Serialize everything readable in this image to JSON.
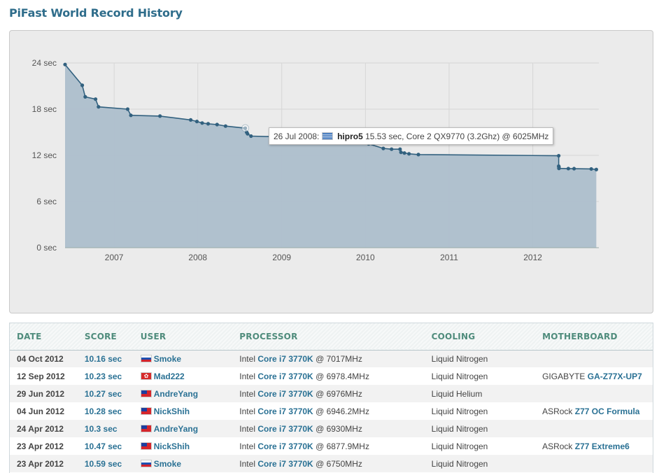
{
  "page_title": "PiFast World Record History",
  "chart_data": {
    "type": "area",
    "title": "",
    "xlabel": "",
    "ylabel": "",
    "y_unit": "sec",
    "ylim": [
      0,
      24
    ],
    "yticks": [
      0,
      6,
      12,
      18,
      24
    ],
    "ytick_labels": [
      "0 sec",
      "6 sec",
      "12 sec",
      "18 sec",
      "24 sec"
    ],
    "xlim": [
      "2006-06-01",
      "2012-10-15"
    ],
    "xticks": [
      "2007-01-01",
      "2008-01-01",
      "2009-01-01",
      "2010-01-01",
      "2011-01-01",
      "2012-01-01"
    ],
    "xtick_labels": [
      "2007",
      "2008",
      "2009",
      "2010",
      "2011",
      "2012"
    ],
    "grid": true,
    "colors": {
      "line": "#32617f",
      "fill": "#adbfcc",
      "plot_bg": "#ebebeb",
      "grid": "#d6d6d6"
    },
    "series": [
      {
        "points": [
          [
            "2006-06-01",
            23.8
          ],
          [
            "2006-08-15",
            21.1
          ],
          [
            "2006-08-28",
            19.6
          ],
          [
            "2006-10-12",
            19.3
          ],
          [
            "2006-10-25",
            18.3
          ],
          [
            "2007-03-01",
            18.0
          ],
          [
            "2007-03-15",
            17.2
          ],
          [
            "2007-07-20",
            17.1
          ],
          [
            "2007-12-01",
            16.6
          ],
          [
            "2007-12-28",
            16.4
          ],
          [
            "2008-01-20",
            16.2
          ],
          [
            "2008-02-15",
            16.1
          ],
          [
            "2008-03-25",
            16.0
          ],
          [
            "2008-05-01",
            15.8
          ],
          [
            "2008-07-26",
            15.53
          ],
          [
            "2008-08-01",
            15.0
          ],
          [
            "2008-08-05",
            14.8
          ],
          [
            "2008-08-20",
            14.5
          ],
          [
            "2008-12-20",
            14.4
          ],
          [
            "2009-04-15",
            14.4
          ],
          [
            "2009-04-25",
            14.3
          ],
          [
            "2009-05-20",
            14.2
          ],
          [
            "2009-10-25",
            14.1
          ],
          [
            "2010-01-15",
            13.5
          ],
          [
            "2010-03-20",
            12.9
          ],
          [
            "2010-04-25",
            12.8
          ],
          [
            "2010-06-01",
            12.8
          ],
          [
            "2010-06-05",
            12.4
          ],
          [
            "2010-06-20",
            12.3
          ],
          [
            "2010-07-10",
            12.2
          ],
          [
            "2010-08-20",
            12.1
          ],
          [
            "2012-04-23",
            11.95
          ],
          [
            "2012-04-23",
            10.59
          ],
          [
            "2012-04-24",
            10.47
          ],
          [
            "2012-04-24",
            10.3
          ],
          [
            "2012-06-04",
            10.28
          ],
          [
            "2012-06-29",
            10.27
          ],
          [
            "2012-09-12",
            10.23
          ],
          [
            "2012-10-04",
            10.16
          ]
        ]
      }
    ],
    "highlighted_point": [
      "2008-07-26",
      15.53
    ],
    "tooltip": {
      "date": "26 Jul 2008:",
      "flag_icon": "greece-flag-icon",
      "user": "hipro5",
      "details": "15.53 sec, Core 2 QX9770 (3.2Ghz) @ 6025MHz"
    }
  },
  "table": {
    "headers": [
      "DATE",
      "SCORE",
      "USER",
      "PROCESSOR",
      "COOLING",
      "MOTHERBOARD"
    ],
    "rows": [
      {
        "date": "04 Oct 2012",
        "score": "10.16 sec",
        "flag": "russia-flag-icon",
        "user": "Smoke",
        "cpu_prefix": "Intel",
        "cpu_model": "Core i7 3770K",
        "cpu_freq": "@ 7017MHz",
        "cooling": "Liquid Nitrogen",
        "mb_brand": "",
        "mb_model": ""
      },
      {
        "date": "12 Sep 2012",
        "score": "10.23 sec",
        "flag": "hong-kong-flag-icon",
        "user": "Mad222",
        "cpu_prefix": "Intel",
        "cpu_model": "Core i7 3770K",
        "cpu_freq": "@ 6978.4MHz",
        "cooling": "Liquid Nitrogen",
        "mb_brand": "GIGABYTE",
        "mb_model": "GA-Z77X-UP7"
      },
      {
        "date": "29 Jun 2012",
        "score": "10.27 sec",
        "flag": "taiwan-flag-icon",
        "user": "AndreYang",
        "cpu_prefix": "Intel",
        "cpu_model": "Core i7 3770K",
        "cpu_freq": "@ 6976MHz",
        "cooling": "Liquid Helium",
        "mb_brand": "",
        "mb_model": ""
      },
      {
        "date": "04 Jun 2012",
        "score": "10.28 sec",
        "flag": "taiwan-flag-icon",
        "user": "NickShih",
        "cpu_prefix": "Intel",
        "cpu_model": "Core i7 3770K",
        "cpu_freq": "@ 6946.2MHz",
        "cooling": "Liquid Nitrogen",
        "mb_brand": "ASRock",
        "mb_model": "Z77 OC Formula"
      },
      {
        "date": "24 Apr 2012",
        "score": "10.3 sec",
        "flag": "taiwan-flag-icon",
        "user": "AndreYang",
        "cpu_prefix": "Intel",
        "cpu_model": "Core i7 3770K",
        "cpu_freq": "@ 6930MHz",
        "cooling": "Liquid Nitrogen",
        "mb_brand": "",
        "mb_model": ""
      },
      {
        "date": "23 Apr 2012",
        "score": "10.47 sec",
        "flag": "taiwan-flag-icon",
        "user": "NickShih",
        "cpu_prefix": "Intel",
        "cpu_model": "Core i7 3770K",
        "cpu_freq": "@ 6877.9MHz",
        "cooling": "Liquid Nitrogen",
        "mb_brand": "ASRock",
        "mb_model": "Z77 Extreme6"
      },
      {
        "date": "23 Apr 2012",
        "score": "10.59 sec",
        "flag": "russia-flag-icon",
        "user": "Smoke",
        "cpu_prefix": "Intel",
        "cpu_model": "Core i7 3770K",
        "cpu_freq": "@ 6750MHz",
        "cooling": "Liquid Nitrogen",
        "mb_brand": "",
        "mb_model": ""
      }
    ]
  }
}
